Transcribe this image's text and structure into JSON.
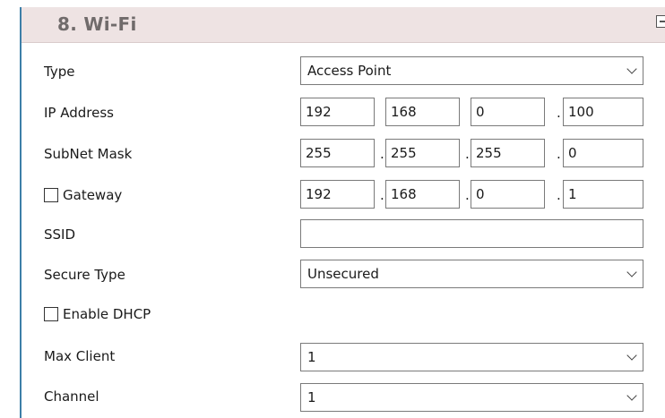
{
  "section": {
    "title": "8. Wi-Fi"
  },
  "fields": {
    "type": {
      "label": "Type",
      "value": "Access Point"
    },
    "ip_address": {
      "label": "IP Address",
      "octets": [
        "192",
        "168",
        "0",
        "100"
      ]
    },
    "subnet_mask": {
      "label": "SubNet Mask",
      "octets": [
        "255",
        "255",
        "255",
        "0"
      ]
    },
    "gateway": {
      "label": "Gateway",
      "checked": false,
      "octets": [
        "192",
        "168",
        "0",
        "1"
      ]
    },
    "ssid": {
      "label": "SSID",
      "value": ""
    },
    "secure_type": {
      "label": "Secure Type",
      "value": "Unsecured"
    },
    "enable_dhcp": {
      "label": "Enable DHCP",
      "checked": false
    },
    "max_client": {
      "label": "Max Client",
      "value": "1"
    },
    "channel": {
      "label": "Channel",
      "value": "1"
    }
  },
  "separator": ".",
  "colors": {
    "accent_border": "#3d7fa8",
    "header_bg": "#eee3e3",
    "header_text": "#706b6b"
  }
}
